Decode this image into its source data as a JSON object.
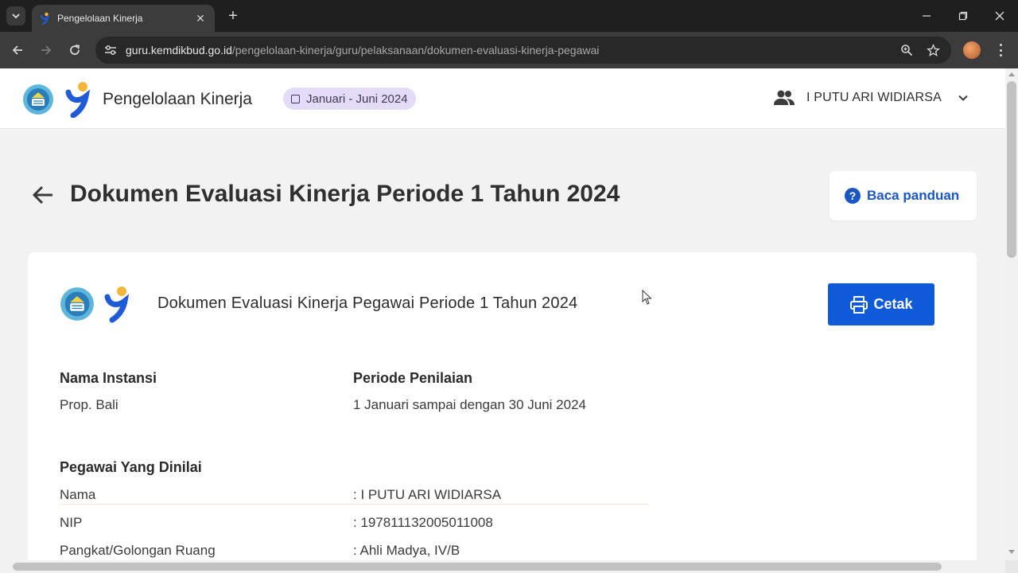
{
  "browser": {
    "tab_title": "Pengelolaan Kinerja",
    "url_host": "guru.kemdikbud.go.id",
    "url_path": "/pengelolaan-kinerja/guru/pelaksanaan/dokumen-evaluasi-kinerja-pegawai",
    "new_tab_label": "+"
  },
  "header": {
    "app_title": "Pengelolaan Kinerja",
    "period_badge": "Januari - Juni 2024",
    "user_name": "I PUTU ARI WIDIARSA"
  },
  "page": {
    "title": "Dokumen Evaluasi Kinerja Periode 1 Tahun 2024",
    "guide_button": "Baca panduan"
  },
  "document": {
    "title": "Dokumen Evaluasi Kinerja Pegawai Periode 1 Tahun 2024",
    "print_button": "Cetak",
    "instansi_label": "Nama Instansi",
    "instansi_value": "Prop. Bali",
    "periode_label": "Periode Penilaian",
    "periode_value": "1 Januari sampai dengan 30 Juni 2024",
    "pegawai_heading": "Pegawai Yang Dinilai",
    "fields": [
      {
        "label": "Nama",
        "value": ": I PUTU ARI WIDIARSA"
      },
      {
        "label": "NIP",
        "value": ": 197811132005011008"
      },
      {
        "label": "Pangkat/Golongan Ruang",
        "value": ": Ahli Madya, IV/B"
      }
    ]
  },
  "colors": {
    "primary": "#0f5ad8",
    "link": "#1a56c4",
    "badge_bg": "#e4dcf7",
    "page_bg": "#f2f2f3"
  }
}
